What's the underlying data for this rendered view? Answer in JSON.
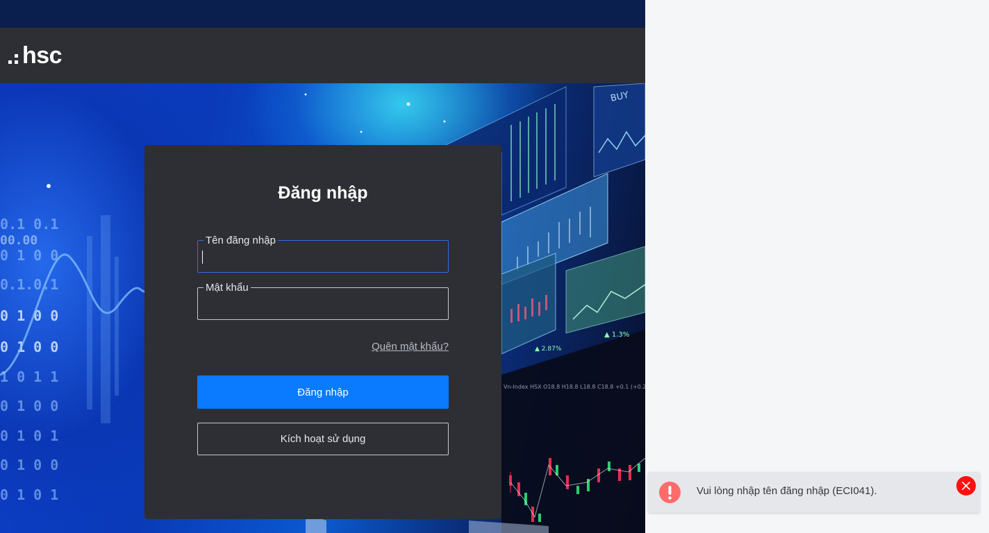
{
  "brand": {
    "logo_text": "hsc"
  },
  "login": {
    "title": "Đăng nhập",
    "username": {
      "label": "Tên đăng nhập",
      "value": ""
    },
    "password": {
      "label": "Mật khẩu",
      "value": ""
    },
    "forgot_password": "Quên mật khẩu?",
    "submit_label": "Đăng nhập",
    "activate_label": "Kích hoạt sử dụng"
  },
  "toast": {
    "message": "Vui lòng nhập tên đăng nhập (ECI041).",
    "icon": "exclamation-icon",
    "close_icon": "close-icon"
  },
  "colors": {
    "primary_button": "#0a7aff",
    "card_background": "#2d2f34",
    "header_background": "#2d2f34",
    "toast_close": "#ff1010",
    "toast_icon": "#ff6b6b"
  }
}
